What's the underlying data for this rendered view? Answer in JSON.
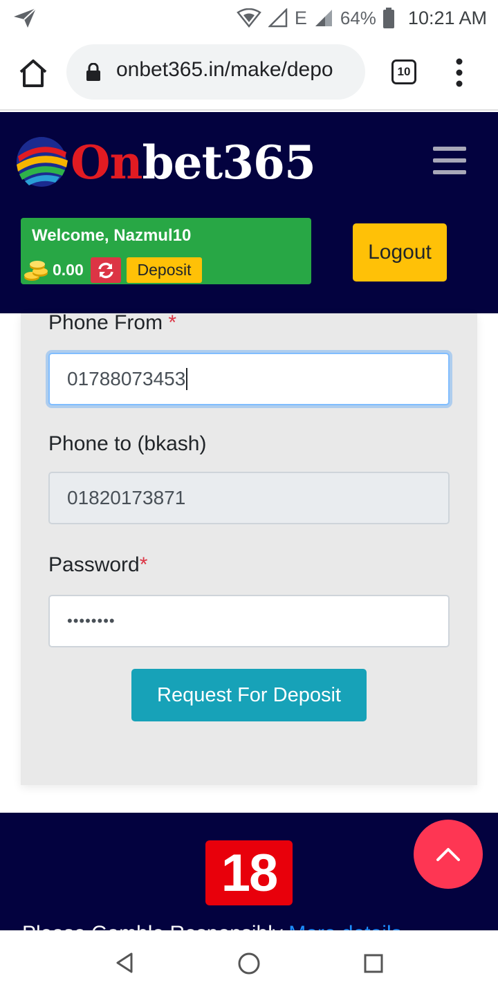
{
  "status_bar": {
    "battery": "64%",
    "time": "10:21 AM",
    "network": "E"
  },
  "browser": {
    "url": "onbet365.in/make/depo",
    "tab_count": "10"
  },
  "header": {
    "logo_part1": "On",
    "logo_part2": "bet365",
    "welcome": "Welcome, Nazmul10",
    "balance": "0.00",
    "deposit_label": "Deposit",
    "logout_label": "Logout"
  },
  "form": {
    "phone_from_label": "Phone From",
    "phone_from_value": "01788073453",
    "phone_to_label": "Phone to (bkash)",
    "phone_to_value": "01820173871",
    "password_label": "Password",
    "password_value": "••••••••",
    "required_mark": "*",
    "submit_label": "Request For Deposit"
  },
  "footer": {
    "age_badge": "18",
    "text_start": "Please Gamble Responsibly ",
    "text_link": "More details"
  },
  "colors": {
    "header_bg": "#03023f",
    "welcome_bg": "#28a745",
    "accent_yellow": "#ffc107",
    "submit_bg": "#17a2b8",
    "scroll_top_bg": "#fe3653"
  }
}
